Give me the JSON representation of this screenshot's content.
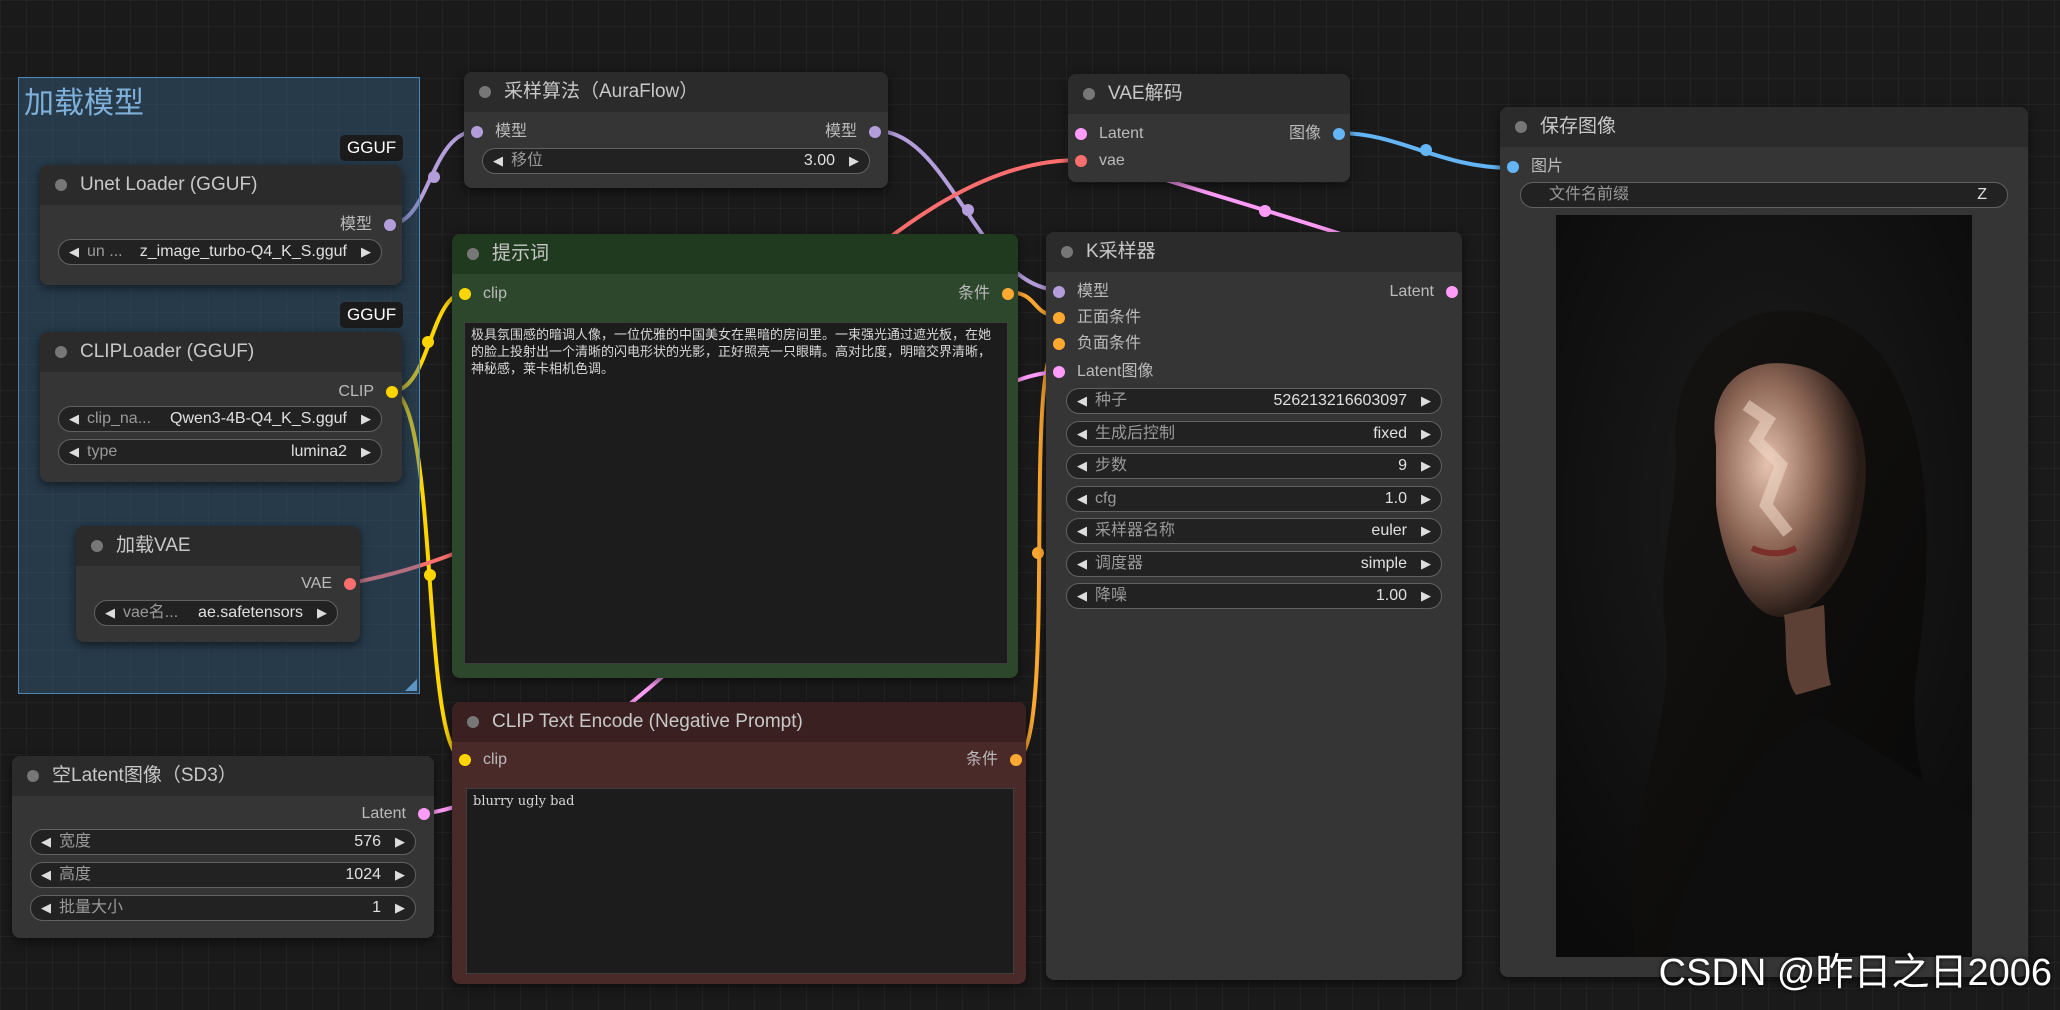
{
  "colors": {
    "model": "#b39ddb",
    "clip": "#ffd500",
    "vae": "#ff6e6e",
    "latent": "#ff9cf9",
    "conditioning": "#ffa931",
    "image": "#64b5f6",
    "prompt_node": "#2a4a2a",
    "negative_node": "#4a2a2a"
  },
  "group": {
    "title": "加载模型"
  },
  "unet": {
    "badge": "GGUF",
    "title": "Unet Loader (GGUF)",
    "out_model": "模型",
    "w_label": "un ...",
    "w_value": "z_image_turbo-Q4_K_S.gguf"
  },
  "clip_loader": {
    "badge": "GGUF",
    "title": "CLIPLoader (GGUF)",
    "out_clip": "CLIP",
    "w1_label": "clip_na...",
    "w1_value": "Qwen3-4B-Q4_K_S.gguf",
    "w2_label": "type",
    "w2_value": "lumina2"
  },
  "vae_loader": {
    "title": "加载VAE",
    "out_vae": "VAE",
    "w_label": "vae名...",
    "w_value": "ae.safetensors"
  },
  "latent": {
    "title": "空Latent图像（SD3）",
    "out_latent": "Latent",
    "w1_label": "宽度",
    "w1_value": "576",
    "w2_label": "高度",
    "w2_value": "1024",
    "w3_label": "批量大小",
    "w3_value": "1"
  },
  "sampling": {
    "title": "采样算法（AuraFlow）",
    "in_model": "模型",
    "out_model": "模型",
    "w_label": "移位",
    "w_value": "3.00"
  },
  "prompt": {
    "title": "提示词",
    "in_clip": "clip",
    "out_cond": "条件",
    "text": "极具氛围感的暗调人像，一位优雅的中国美女在黑暗的房间里。一束强光通过遮光板，在她的脸上投射出一个清晰的闪电形状的光影，正好照亮一只眼睛。高对比度，明暗交界清晰，神秘感，莱卡相机色调。"
  },
  "negative": {
    "title": "CLIP Text Encode (Negative Prompt)",
    "in_clip": "clip",
    "out_cond": "条件",
    "text": "blurry ugly bad"
  },
  "vae_decode": {
    "title": "VAE解码",
    "in_latent": "Latent",
    "in_vae": "vae",
    "out_image": "图像"
  },
  "ksampler": {
    "title": "K采样器",
    "in_model": "模型",
    "in_positive": "正面条件",
    "in_negative": "负面条件",
    "in_latent": "Latent图像",
    "out_latent": "Latent",
    "widgets": [
      {
        "label": "种子",
        "value": "526213216603097"
      },
      {
        "label": "生成后控制",
        "value": "fixed"
      },
      {
        "label": "步数",
        "value": "9"
      },
      {
        "label": "cfg",
        "value": "1.0"
      },
      {
        "label": "采样器名称",
        "value": "euler"
      },
      {
        "label": "调度器",
        "value": "simple"
      },
      {
        "label": "降噪",
        "value": "1.00"
      }
    ]
  },
  "save": {
    "title": "保存图像",
    "in_images": "图片",
    "w_label": "文件名前缀",
    "w_value": "Z"
  },
  "watermark": "CSDN @昨日之日2006"
}
